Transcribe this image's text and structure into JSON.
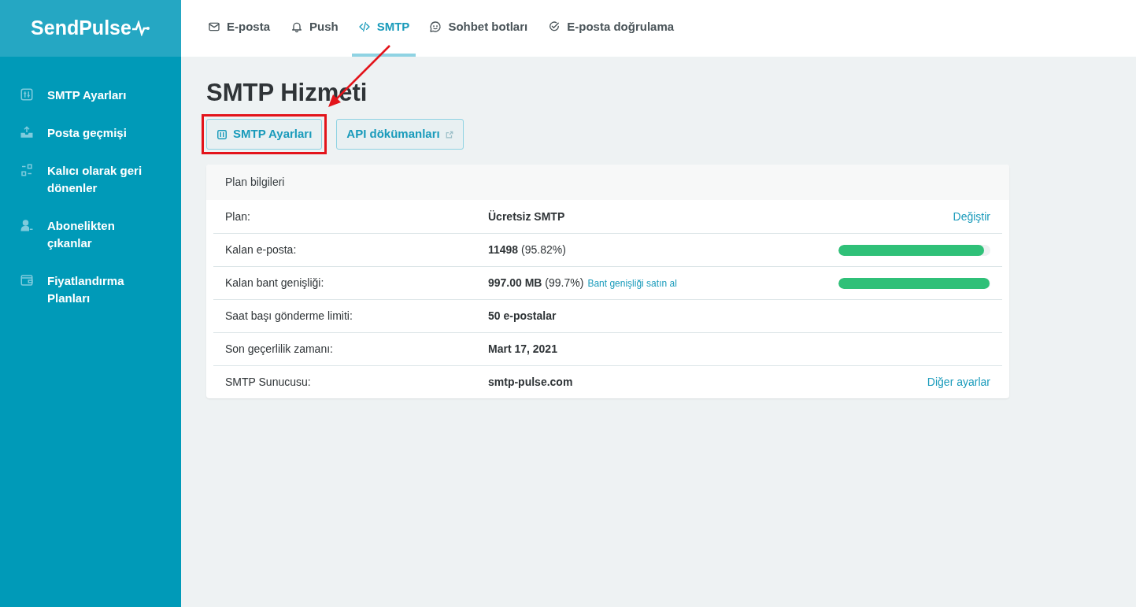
{
  "logo": "SendPulse",
  "top_nav": [
    {
      "label": "E-posta",
      "selected": false
    },
    {
      "label": "Push",
      "selected": false
    },
    {
      "label": "SMTP",
      "selected": true
    },
    {
      "label": "Sohbet botları",
      "selected": false
    },
    {
      "label": "E-posta doğrulama",
      "selected": false
    }
  ],
  "sidebar": {
    "items": [
      {
        "label": "SMTP Ayarları"
      },
      {
        "label": "Posta geçmişi"
      },
      {
        "label": "Kalıcı olarak geri dönenler"
      },
      {
        "label": "Abonelikten çıkanlar"
      },
      {
        "label": "Fiyatlandırma Planları"
      }
    ]
  },
  "page_title": "SMTP Hizmeti",
  "buttons": [
    {
      "label": "SMTP Ayarları",
      "kind": "settings",
      "highlighted": true
    },
    {
      "label": "API dökümanları",
      "kind": "external",
      "highlighted": false
    }
  ],
  "plan": {
    "header": "Plan bilgileri",
    "rows": [
      {
        "label": "Plan:",
        "value": "**Ücretsiz SMTP**",
        "action": "Değiştir"
      },
      {
        "label": "Kalan e-posta:",
        "value": "**11498** (95.82%)",
        "level": 0.958
      },
      {
        "label": "Kalan bant genişliği:",
        "value": "**997.00 MB** (99.7%)",
        "link": "Bant genişliği satın al",
        "level": 0.997
      },
      {
        "label": "Saat başı gönderme limiti:",
        "value": "**50 e-postalar**"
      },
      {
        "label": "Son geçerlilik zamanı:",
        "value": "**Mart 17, 2021**"
      },
      {
        "label": "SMTP Sunucusu:",
        "value": "**smtp-pulse.com**",
        "action": "Diğer ayarlar"
      }
    ]
  }
}
